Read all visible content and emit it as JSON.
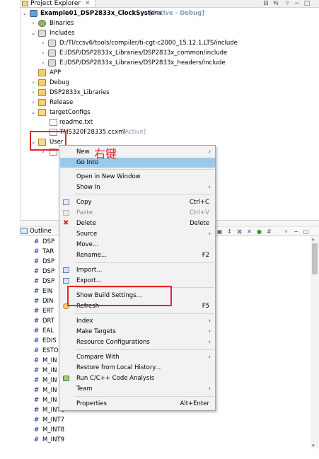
{
  "project_explorer": {
    "tab_title": "Project Explorer",
    "tab_close": "✕",
    "items": [
      {
        "label": "Example01_DSP2833x_ClockSystem",
        "suffix": " [Active - Debug]"
      },
      {
        "label": "Binaries"
      },
      {
        "label": "Includes"
      },
      {
        "label": "D:/TI/ccsv6/tools/compiler/ti-cgt-c2000_15.12.1.LTS/include"
      },
      {
        "label": "E:/DSP/DSP2833x_Libraries/DSP2833x_common/include"
      },
      {
        "label": "E:/DSP/DSP2833x_Libraries/DSP2833x_headers/include"
      },
      {
        "label": "APP"
      },
      {
        "label": "Debug"
      },
      {
        "label": "DSP2833x_Libraries"
      },
      {
        "label": "Release"
      },
      {
        "label": "targetConfigs"
      },
      {
        "label": "readme.txt"
      },
      {
        "label": "TMS320F28335.ccxml",
        "suffix": " [Active]"
      },
      {
        "label": "User"
      }
    ]
  },
  "outline": {
    "tab_title": "Outline",
    "items": [
      "DSP",
      "TAR",
      "DSP",
      "DSP",
      "DSP",
      "EIN",
      "DIN",
      "ERT",
      "DRT",
      "EAL",
      "EDIS",
      "ESTO",
      "M_IN",
      "M_IN",
      "M_IN",
      "M_IN",
      "M_IN",
      "M_INT6",
      "M_INT7",
      "M_INT8",
      "M_INT9"
    ]
  },
  "context_menu": {
    "items": [
      {
        "label": "New",
        "sub": "›"
      },
      {
        "label": "Go Into"
      },
      {
        "label": "Open in New Window"
      },
      {
        "label": "Show In",
        "sub": "›"
      },
      {
        "label": "Copy",
        "key": "Ctrl+C"
      },
      {
        "label": "Paste",
        "key": "Ctrl+V"
      },
      {
        "label": "Delete",
        "key": "Delete"
      },
      {
        "label": "Source",
        "sub": "›"
      },
      {
        "label": "Move..."
      },
      {
        "label": "Rename...",
        "key": "F2"
      },
      {
        "label": "Import..."
      },
      {
        "label": "Export..."
      },
      {
        "label": "Show Build Settings..."
      },
      {
        "label": "Refresh",
        "key": "F5"
      },
      {
        "label": "Index",
        "sub": "›"
      },
      {
        "label": "Make Targets",
        "sub": "›"
      },
      {
        "label": "Resource Configurations",
        "sub": "›"
      },
      {
        "label": "Compare With",
        "sub": "›"
      },
      {
        "label": "Restore from Local History..."
      },
      {
        "label": "Run C/C++ Code Analysis"
      },
      {
        "label": "Team",
        "sub": "›"
      },
      {
        "label": "Properties",
        "key": "Alt+Enter"
      }
    ]
  },
  "annotation": {
    "text": "右键",
    "color": "#e0262c"
  },
  "colors": {
    "selection": "#9bc9ec",
    "active_tag": "#8a9bb3",
    "accent_red": "#e0262c"
  }
}
